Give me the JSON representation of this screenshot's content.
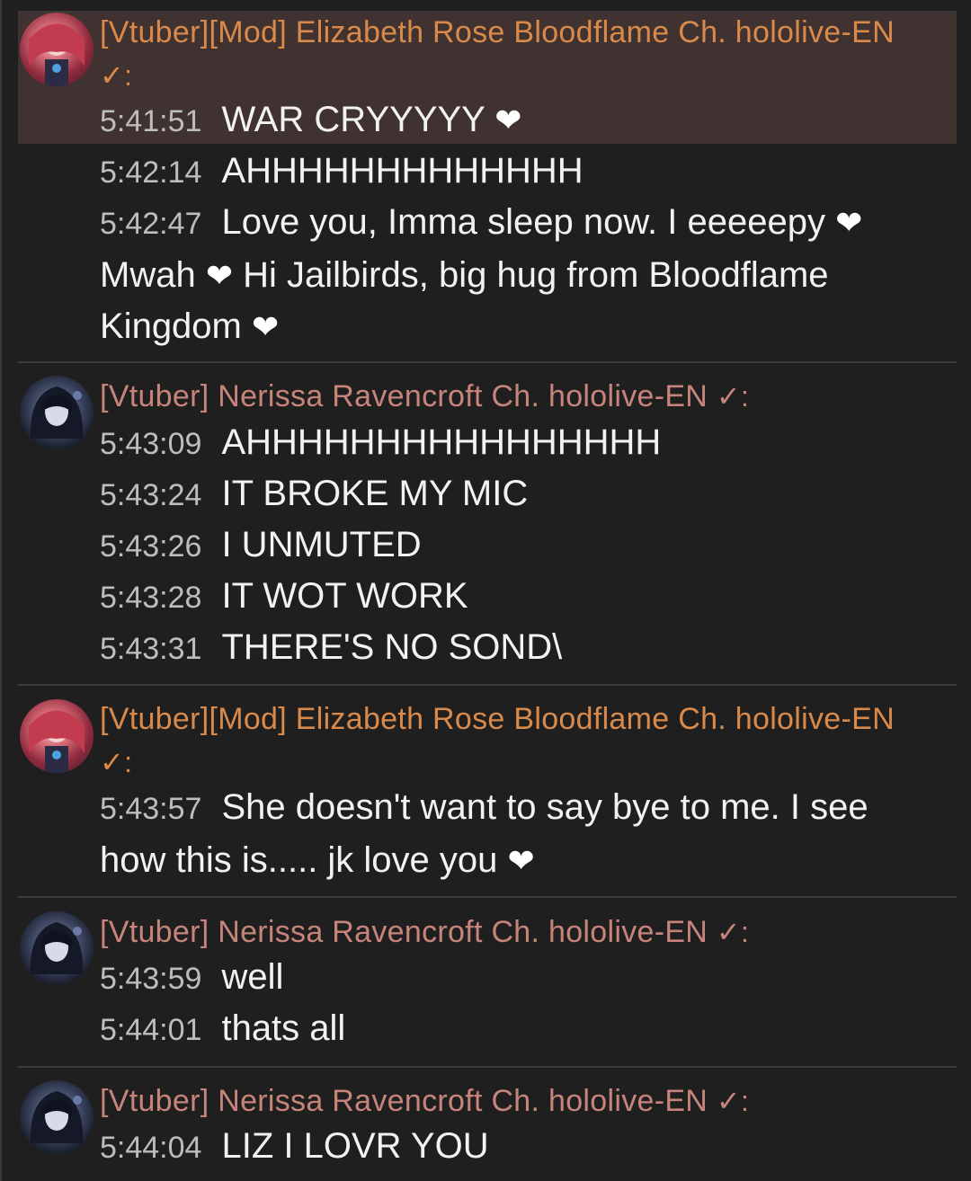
{
  "authors": {
    "liz": "[Vtuber][Mod] Elizabeth Rose Bloodflame Ch. hololive-EN",
    "nerissa": "[Vtuber] Nerissa Ravencroft Ch. hololive-EN"
  },
  "verified_mark": "✓:",
  "heart": "❤",
  "groups": [
    {
      "messages": [
        {
          "time": "5:41:51",
          "text": "WAR CRYYYYY"
        },
        {
          "time": "5:42:14",
          "text": "AHHHHHHHHHHHHH"
        },
        {
          "time": "5:42:47",
          "text_parts": [
            "Love you, Imma sleep now. I eeeeepy",
            "Mwah",
            "Hi Jailbirds, big hug from Bloodflame Kingdom"
          ]
        }
      ]
    },
    {
      "messages": [
        {
          "time": "5:43:09",
          "text": "AHHHHHHHHHHHHHHHH"
        },
        {
          "time": "5:43:24",
          "text": "IT BROKE MY MIC"
        },
        {
          "time": "5:43:26",
          "text": "I UNMUTED"
        },
        {
          "time": "5:43:28",
          "text": "IT WOT WORK"
        },
        {
          "time": "5:43:31",
          "text": "THERE'S NO SOND\\"
        }
      ]
    },
    {
      "messages": [
        {
          "time": "5:43:57",
          "text": "She doesn't want to say bye to me. I see how this is..... jk love you"
        }
      ]
    },
    {
      "messages": [
        {
          "time": "5:43:59",
          "text": "well"
        },
        {
          "time": "5:44:01",
          "text": "thats all"
        }
      ]
    },
    {
      "messages": [
        {
          "time": "5:44:04",
          "text": "LIZ I LOVR YOU"
        }
      ]
    }
  ],
  "colors": {
    "background": "#1f1f1f",
    "highlight": "#3f3230",
    "liz_author": "#d98a4a",
    "nerissa_author": "#c7847a",
    "timestamp": "#bdbdbd"
  }
}
